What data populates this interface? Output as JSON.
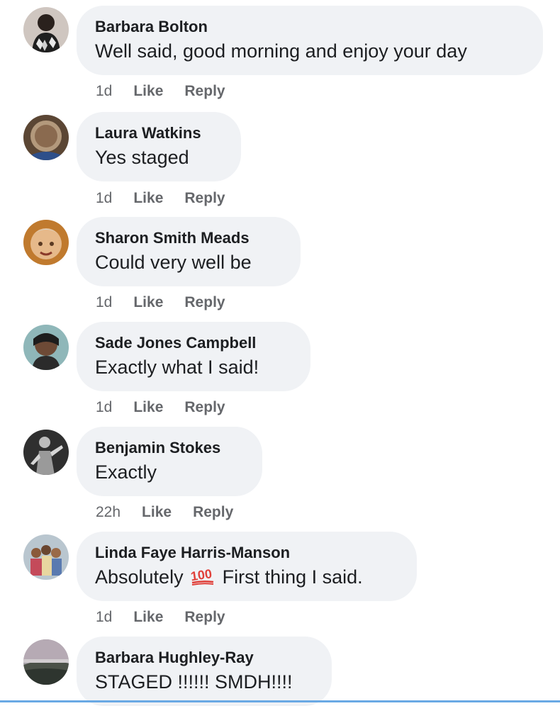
{
  "comments": [
    {
      "author": "Barbara Bolton",
      "text": "Well said, good morning and enjoy your day",
      "time": "1d",
      "like_label": "Like",
      "reply_label": "Reply",
      "avatar_icon": "person-photo-icon"
    },
    {
      "author": "Laura Watkins",
      "text": "Yes staged",
      "time": "1d",
      "like_label": "Like",
      "reply_label": "Reply",
      "avatar_icon": "person-photo-icon"
    },
    {
      "author": "Sharon Smith Meads",
      "text": "Could very well be",
      "time": "1d",
      "like_label": "Like",
      "reply_label": "Reply",
      "avatar_icon": "person-photo-icon"
    },
    {
      "author": "Sade Jones Campbell",
      "text": "Exactly what I said!",
      "time": "1d",
      "like_label": "Like",
      "reply_label": "Reply",
      "avatar_icon": "person-photo-icon"
    },
    {
      "author": "Benjamin Stokes",
      "text": "Exactly",
      "time": "22h",
      "like_label": "Like",
      "reply_label": "Reply",
      "avatar_icon": "person-photo-icon"
    },
    {
      "author": "Linda Faye Harris-Manson",
      "text_before": "Absolutely",
      "emoji": "100-emoji-icon",
      "text_after": "First thing I said.",
      "time": "1d",
      "like_label": "Like",
      "reply_label": "Reply",
      "avatar_icon": "person-photo-icon"
    },
    {
      "author": "Barbara Hughley-Ray",
      "text": "STAGED !!!!!! SMDH!!!!",
      "avatar_icon": "landscape-photo-icon"
    }
  ],
  "colors": {
    "bubble_bg": "#f0f2f5",
    "text": "#1c1e21",
    "meta": "#65676b",
    "divider": "#6aa9e4"
  }
}
